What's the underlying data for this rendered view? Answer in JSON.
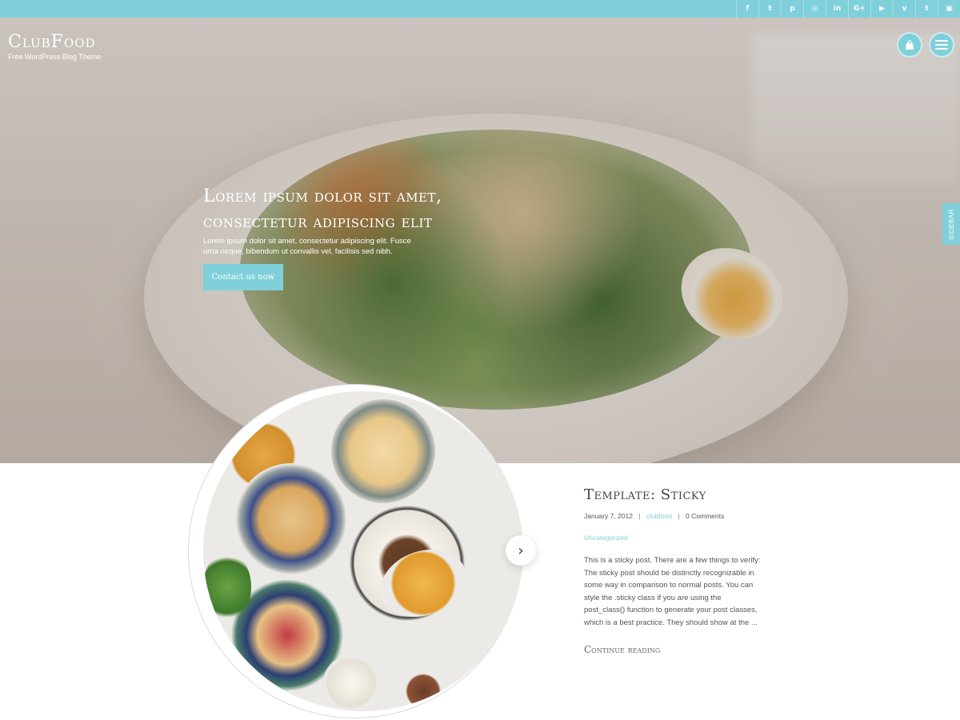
{
  "colors": {
    "accent": "#7fd0da",
    "text": "#555555",
    "heading": "#444444"
  },
  "social_icons": [
    {
      "name": "facebook-icon",
      "glyph": "f"
    },
    {
      "name": "twitter-icon",
      "glyph": "t"
    },
    {
      "name": "pinterest-icon",
      "glyph": "p"
    },
    {
      "name": "instagram-icon",
      "glyph": "◎"
    },
    {
      "name": "linkedin-icon",
      "glyph": "in"
    },
    {
      "name": "google-plus-icon",
      "glyph": "G+"
    },
    {
      "name": "youtube-icon",
      "glyph": "▶"
    },
    {
      "name": "vimeo-icon",
      "glyph": "v"
    },
    {
      "name": "tumblr-icon",
      "glyph": "t"
    },
    {
      "name": "flickr-icon",
      "glyph": "▣"
    }
  ],
  "site": {
    "name": "ClubFood",
    "tagline": "Free WordPress Blog Theme"
  },
  "header": {
    "cart_icon": "shopping-bag-icon",
    "menu_icon": "hamburger-menu-icon"
  },
  "sidebar_tab": {
    "label": "SIDEBAR"
  },
  "hero": {
    "title": "Lorem ipsum dolor sit amet, consectetur adipiscing elit",
    "subtitle": "Lorem ipsum dolor sit amet, consectetur adipiscing elit. Fusce urna neque, bibendum ut convallis vel, facilisis sed nibh.",
    "button_label": "Contact us now"
  },
  "carousel": {
    "next_icon": "chevron-right-icon",
    "next_glyph": "›"
  },
  "post": {
    "title": "Template: Sticky",
    "date": "January 7, 2012",
    "author": "clubfood",
    "comments": "0 Comments",
    "category": "Uncategorized",
    "excerpt": "This is a sticky post. There are a few things to verify: The sticky post should be distinctly recognizable in some way in comparison to normal posts. You can style the .sticky class if you are using the post_class() function to generate your post classes, which is a best practice. They should show at the ...",
    "read_more": "Continue reading",
    "separator": "|"
  }
}
